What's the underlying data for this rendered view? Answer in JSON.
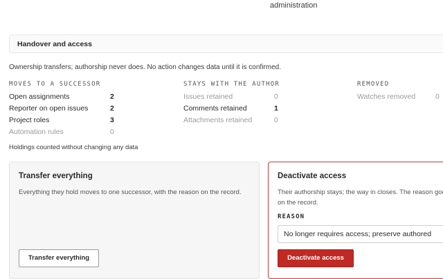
{
  "top_fragment": "administration",
  "section": {
    "title": "Handover and access"
  },
  "notice": "Ownership transfers; authorship never does. No action changes data until it is confirmed.",
  "columns": [
    {
      "heading": "MOVES TO A SUCCESSOR",
      "rows": [
        {
          "label": "Open assignments",
          "value": "2",
          "emphasis": true
        },
        {
          "label": "Reporter on open issues",
          "value": "2",
          "emphasis": true
        },
        {
          "label": "Project roles",
          "value": "3",
          "emphasis": true
        },
        {
          "label": "Automation rules",
          "value": "0",
          "emphasis": false
        }
      ]
    },
    {
      "heading": "STAYS WITH THE AUTHOR",
      "rows": [
        {
          "label": "Issues retained",
          "value": "0",
          "emphasis": false
        },
        {
          "label": "Comments retained",
          "value": "1",
          "emphasis": true
        },
        {
          "label": "Attachments retained",
          "value": "0",
          "emphasis": false
        }
      ]
    },
    {
      "heading": "REMOVED",
      "rows": [
        {
          "label": "Watches removed",
          "value": "0",
          "emphasis": false
        }
      ]
    }
  ],
  "footnote": "Holdings counted without changing any data",
  "transfer_card": {
    "title": "Transfer everything",
    "description": "Everything they hold moves to one successor, with the reason on the record.",
    "button_label": "Transfer everything"
  },
  "deactivate_card": {
    "title": "Deactivate access",
    "description": "Their authorship stays; the way in closes. The reason goes on the record.",
    "reason_label": "REASON",
    "reason_value": "No longer requires access; preserve authored",
    "button_label": "Deactivate access",
    "accent_color": "#c83a32"
  }
}
